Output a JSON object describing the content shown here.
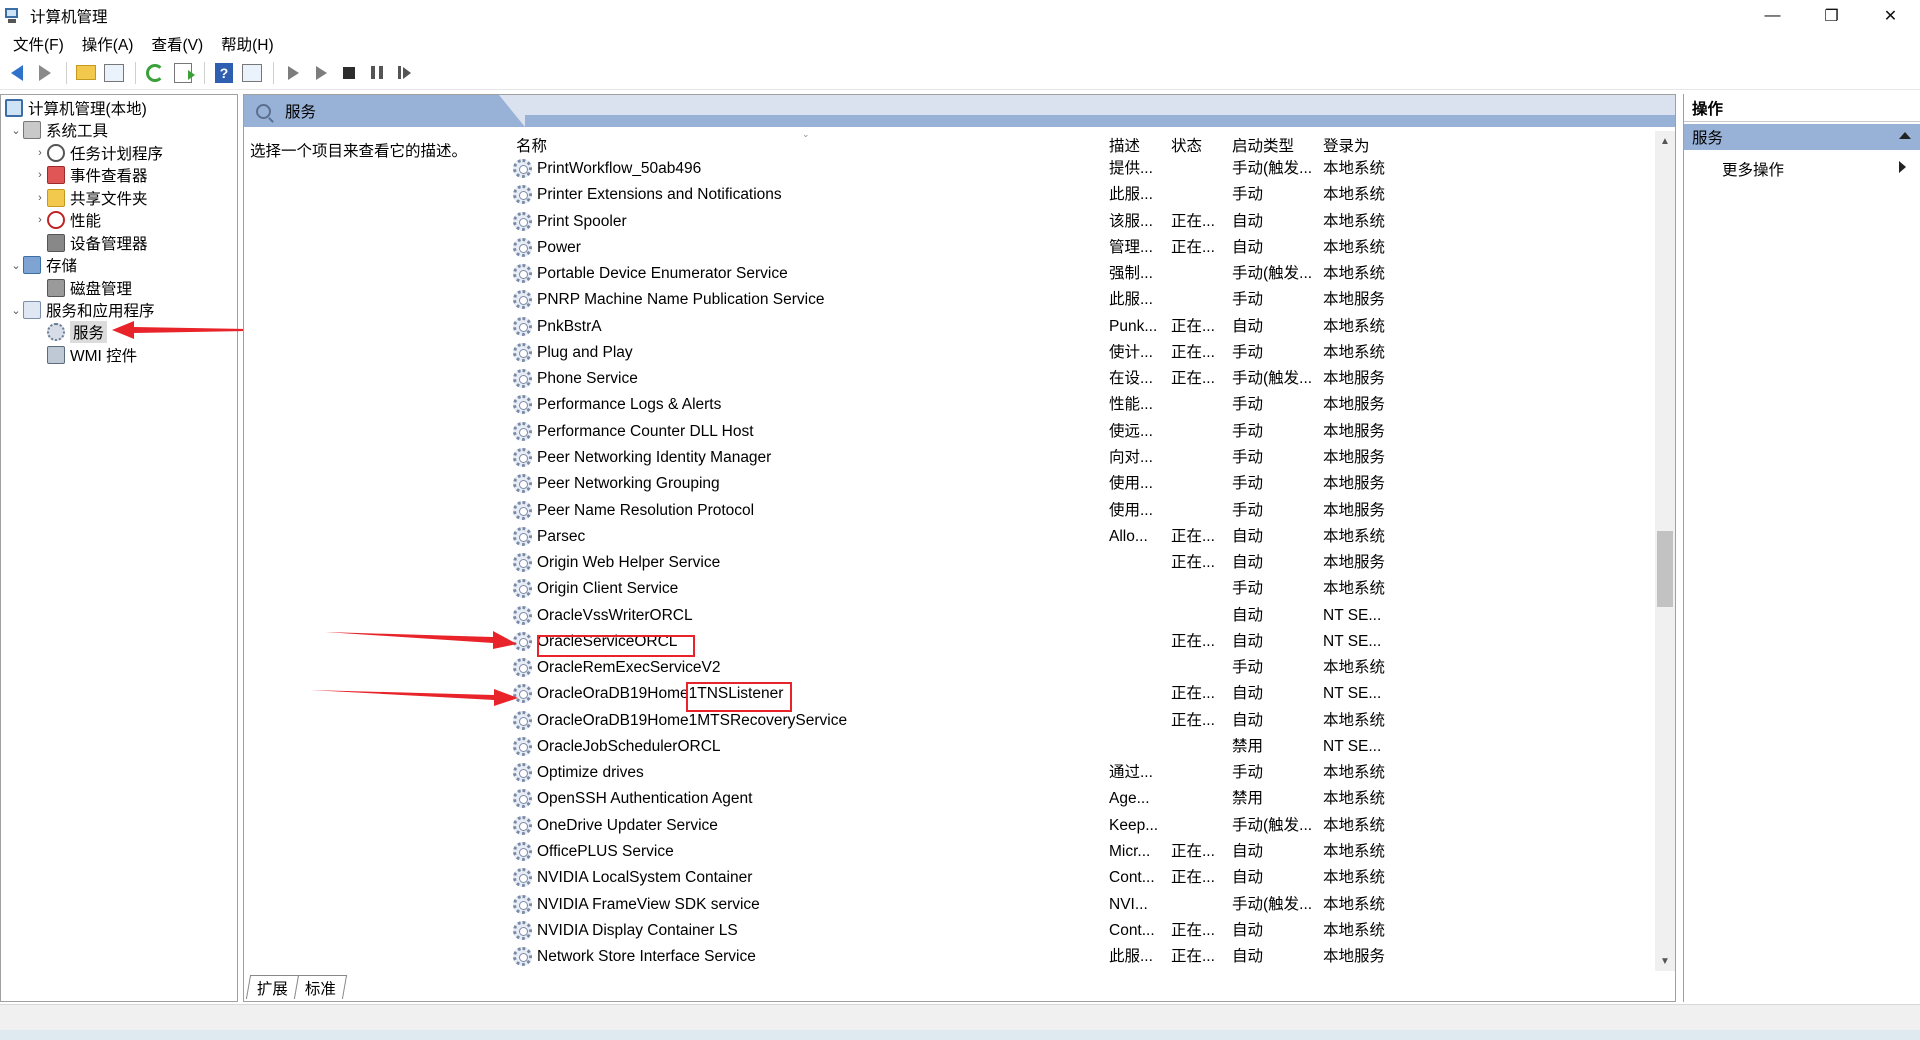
{
  "window": {
    "title": "计算机管理",
    "minimize_icon": "minimize-icon",
    "restore_icon": "restore-icon",
    "close_icon": "close-icon"
  },
  "menu": [
    "文件(F)",
    "操作(A)",
    "查看(V)",
    "帮助(H)"
  ],
  "toolbar": {
    "icons": [
      "back-arrow-icon",
      "forward-arrow-icon",
      "up-folder-icon",
      "show-hide-tree-icon",
      "refresh-icon",
      "export-list-icon",
      "help-icon",
      "show-hide-action-pane-icon",
      "start-service-icon",
      "start-service-alt-icon",
      "stop-service-icon",
      "pause-service-icon",
      "restart-service-icon"
    ]
  },
  "tree": {
    "root": "计算机管理(本地)",
    "system_tools": "系统工具",
    "task_scheduler": "任务计划程序",
    "event_viewer": "事件查看器",
    "shared_folders": "共享文件夹",
    "performance": "性能",
    "device_manager": "设备管理器",
    "storage": "存储",
    "disk_management": "磁盘管理",
    "services_apps": "服务和应用程序",
    "services": "服务",
    "wmi": "WMI 控件"
  },
  "middle": {
    "tab_title": "服务",
    "description_hint": "选择一个项目来查看它的描述。",
    "columns": {
      "name": "名称",
      "desc": "描述",
      "state": "状态",
      "startup": "启动类型",
      "logon": "登录为"
    },
    "services": [
      {
        "name": "PrintWorkflow_50ab496",
        "desc": "提供...",
        "state": "",
        "startup": "手动(触发...",
        "logon": "本地系统"
      },
      {
        "name": "Printer Extensions and Notifications",
        "desc": "此服...",
        "state": "",
        "startup": "手动",
        "logon": "本地系统"
      },
      {
        "name": "Print Spooler",
        "desc": "该服...",
        "state": "正在...",
        "startup": "自动",
        "logon": "本地系统"
      },
      {
        "name": "Power",
        "desc": "管理...",
        "state": "正在...",
        "startup": "自动",
        "logon": "本地系统"
      },
      {
        "name": "Portable Device Enumerator Service",
        "desc": "强制...",
        "state": "",
        "startup": "手动(触发...",
        "logon": "本地系统"
      },
      {
        "name": "PNRP Machine Name Publication Service",
        "desc": "此服...",
        "state": "",
        "startup": "手动",
        "logon": "本地服务"
      },
      {
        "name": "PnkBstrA",
        "desc": "Punk...",
        "state": "正在...",
        "startup": "自动",
        "logon": "本地系统"
      },
      {
        "name": "Plug and Play",
        "desc": "使计...",
        "state": "正在...",
        "startup": "手动",
        "logon": "本地系统"
      },
      {
        "name": "Phone Service",
        "desc": "在设...",
        "state": "正在...",
        "startup": "手动(触发...",
        "logon": "本地服务"
      },
      {
        "name": "Performance Logs & Alerts",
        "desc": "性能...",
        "state": "",
        "startup": "手动",
        "logon": "本地服务"
      },
      {
        "name": "Performance Counter DLL Host",
        "desc": "使远...",
        "state": "",
        "startup": "手动",
        "logon": "本地服务"
      },
      {
        "name": "Peer Networking Identity Manager",
        "desc": "向对...",
        "state": "",
        "startup": "手动",
        "logon": "本地服务"
      },
      {
        "name": "Peer Networking Grouping",
        "desc": "使用...",
        "state": "",
        "startup": "手动",
        "logon": "本地服务"
      },
      {
        "name": "Peer Name Resolution Protocol",
        "desc": "使用...",
        "state": "",
        "startup": "手动",
        "logon": "本地服务"
      },
      {
        "name": "Parsec",
        "desc": "Allo...",
        "state": "正在...",
        "startup": "自动",
        "logon": "本地系统"
      },
      {
        "name": "Origin Web Helper Service",
        "desc": "",
        "state": "正在...",
        "startup": "自动",
        "logon": "本地服务"
      },
      {
        "name": "Origin Client Service",
        "desc": "",
        "state": "",
        "startup": "手动",
        "logon": "本地系统"
      },
      {
        "name": "OracleVssWriterORCL",
        "desc": "",
        "state": "",
        "startup": "自动",
        "logon": "NT SE..."
      },
      {
        "name": "OracleServiceORCL",
        "desc": "",
        "state": "正在...",
        "startup": "自动",
        "logon": "NT SE..."
      },
      {
        "name": "OracleRemExecServiceV2",
        "desc": "",
        "state": "",
        "startup": "手动",
        "logon": "本地系统"
      },
      {
        "name": "OracleOraDB19Home1TNSListener",
        "desc": "",
        "state": "正在...",
        "startup": "自动",
        "logon": "NT SE..."
      },
      {
        "name": "OracleOraDB19Home1MTSRecoveryService",
        "desc": "",
        "state": "正在...",
        "startup": "自动",
        "logon": "本地系统"
      },
      {
        "name": "OracleJobSchedulerORCL",
        "desc": "",
        "state": "",
        "startup": "禁用",
        "logon": "NT SE..."
      },
      {
        "name": "Optimize drives",
        "desc": "通过...",
        "state": "",
        "startup": "手动",
        "logon": "本地系统"
      },
      {
        "name": "OpenSSH Authentication Agent",
        "desc": "Age...",
        "state": "",
        "startup": "禁用",
        "logon": "本地系统"
      },
      {
        "name": "OneDrive Updater Service",
        "desc": "Keep...",
        "state": "",
        "startup": "手动(触发...",
        "logon": "本地系统"
      },
      {
        "name": "OfficePLUS Service",
        "desc": "Micr...",
        "state": "正在...",
        "startup": "自动",
        "logon": "本地系统"
      },
      {
        "name": "NVIDIA LocalSystem Container",
        "desc": "Cont...",
        "state": "正在...",
        "startup": "自动",
        "logon": "本地系统"
      },
      {
        "name": "NVIDIA FrameView SDK service",
        "desc": "NVI...",
        "state": "",
        "startup": "手动(触发...",
        "logon": "本地系统"
      },
      {
        "name": "NVIDIA Display Container LS",
        "desc": "Cont...",
        "state": "正在...",
        "startup": "自动",
        "logon": "本地系统"
      },
      {
        "name": "Network Store Interface Service",
        "desc": "此服...",
        "state": "正在...",
        "startup": "自动",
        "logon": "本地服务"
      }
    ],
    "tabs": [
      "扩展",
      "标准"
    ]
  },
  "actions": {
    "title": "操作",
    "section": "服务",
    "more": "更多操作"
  },
  "colors": {
    "accent_header": "#98b1d6",
    "annotation_red": "#e8242a"
  }
}
